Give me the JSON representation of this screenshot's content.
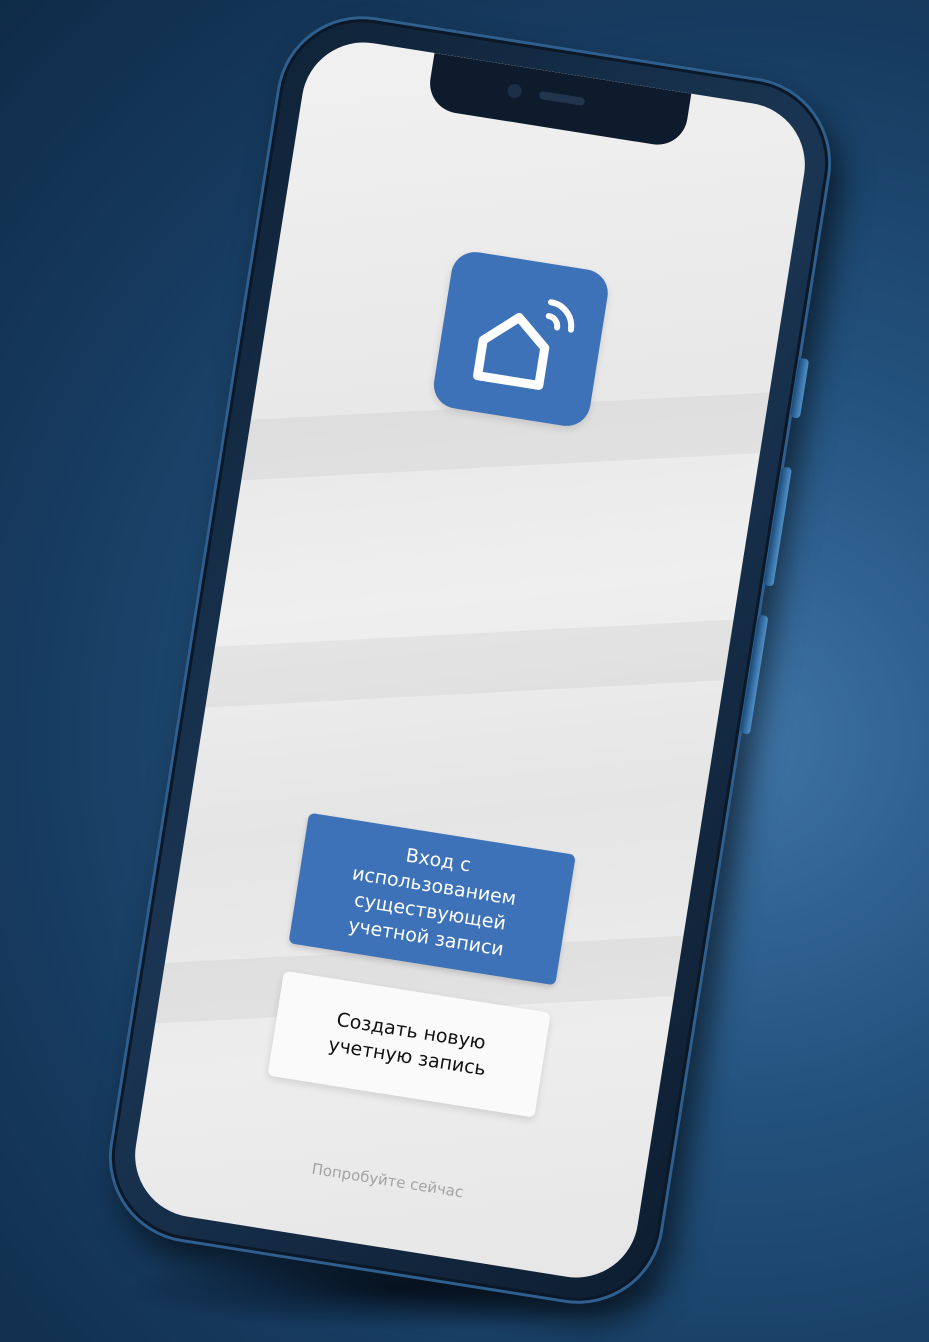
{
  "colors": {
    "brand": "#3d72b8",
    "logo_bg": "#3d72b8",
    "logo_stroke": "#ffffff",
    "secondary_button_bg": "#fafafa",
    "link_text": "#a3a3a3"
  },
  "logo": {
    "icon": "smart-home-wifi-icon"
  },
  "buttons": {
    "login_existing_label": "Вход с использованием существующей учетной записи",
    "create_account_label": "Создать новую учетную запись"
  },
  "footer": {
    "try_now_label": "Попробуйте сейчас"
  }
}
